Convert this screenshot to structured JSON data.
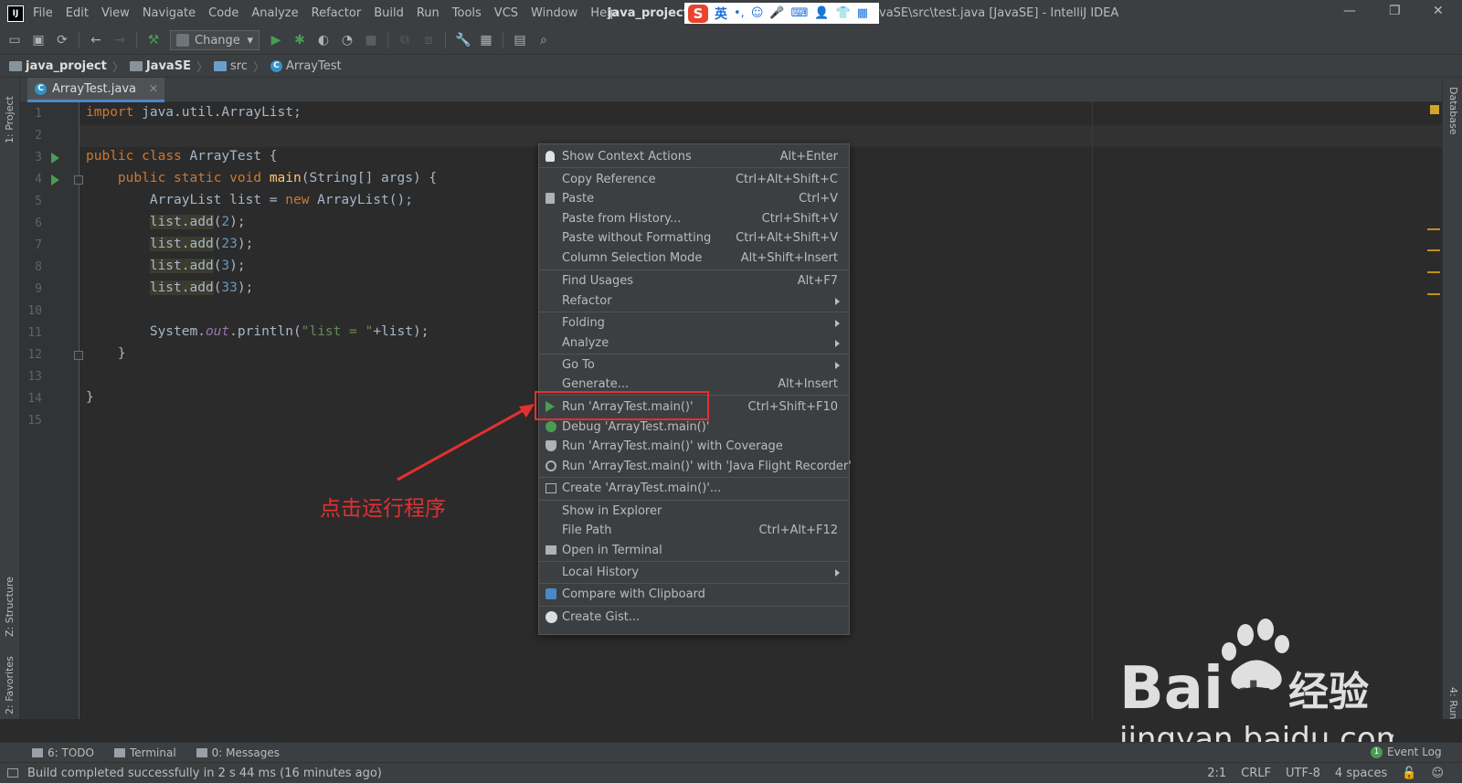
{
  "menubar": {
    "items": [
      "File",
      "Edit",
      "View",
      "Navigate",
      "Code",
      "Analyze",
      "Refactor",
      "Build",
      "Run",
      "Tools",
      "VCS",
      "Window",
      "Help"
    ],
    "title_project": "java_project",
    "title_prefix": "[",
    "title_suffix": "vaSE\\src\\test.java [JavaSE] - IntelliJ IDEA",
    "app_icon_text": "IJ"
  },
  "ime": {
    "logo": "S",
    "lang": "英",
    "punct": "•,",
    "icons": [
      "☺",
      "🎤",
      "⌨",
      "👤",
      "👕",
      "▦"
    ]
  },
  "toolbar": {
    "run_config_label": "Change"
  },
  "breadcrumb": {
    "items": [
      "java_project",
      "JavaSE",
      "src",
      "ArrayTest"
    ]
  },
  "editor": {
    "tab_label": "ArrayTest.java",
    "line_numbers": [
      "1",
      "2",
      "3",
      "4",
      "5",
      "6",
      "7",
      "8",
      "9",
      "10",
      "11",
      "12",
      "13",
      "14",
      "15"
    ]
  },
  "code": {
    "l1_kw": "import",
    "l1_rest": " java.util.ArrayList;",
    "l3_kw1": "public",
    "l3_kw2": "class",
    "l3_rest": " ArrayTest {",
    "l4_indent": "    ",
    "l4_kw1": "public",
    "l4_kw2": "static",
    "l4_kw3": "void",
    "l4_fn": "main",
    "l4_rest": "(String[] args) {",
    "l5_a": "        ArrayList list = ",
    "l5_kw": "new",
    "l5_b": " ArrayList();",
    "l6_call": "list.add",
    "l6_num": "2",
    "l7_call": "list.add",
    "l7_num": "23",
    "l8_call": "list.add",
    "l8_num": "3",
    "l9_call": "list.add",
    "l9_num": "33",
    "l11_a": "        System.",
    "l11_out": "out",
    "l11_b": ".println(",
    "l11_str": "\"list = \"",
    "l11_c": "+list);",
    "l12": "    }",
    "l14": "}"
  },
  "context_menu": {
    "items": [
      {
        "label": "Show Context Actions",
        "shortcut": "Alt+Enter"
      },
      {
        "label": "Copy Reference",
        "shortcut": "Ctrl+Alt+Shift+C"
      },
      {
        "label": "Paste",
        "shortcut": "Ctrl+V"
      },
      {
        "label": "Paste from History...",
        "shortcut": "Ctrl+Shift+V"
      },
      {
        "label": "Paste without Formatting",
        "shortcut": "Ctrl+Alt+Shift+V"
      },
      {
        "label": "Column Selection Mode",
        "shortcut": "Alt+Shift+Insert"
      },
      {
        "label": "Find Usages",
        "shortcut": "Alt+F7"
      },
      {
        "label": "Refactor",
        "shortcut": ""
      },
      {
        "label": "Folding",
        "shortcut": ""
      },
      {
        "label": "Analyze",
        "shortcut": ""
      },
      {
        "label": "Go To",
        "shortcut": ""
      },
      {
        "label": "Generate...",
        "shortcut": "Alt+Insert"
      },
      {
        "label": "Run 'ArrayTest.main()'",
        "shortcut": "Ctrl+Shift+F10"
      },
      {
        "label": "Debug 'ArrayTest.main()'",
        "shortcut": ""
      },
      {
        "label": "Run 'ArrayTest.main()' with Coverage",
        "shortcut": ""
      },
      {
        "label": "Run 'ArrayTest.main()' with 'Java Flight Recorder'",
        "shortcut": ""
      },
      {
        "label": "Create 'ArrayTest.main()'...",
        "shortcut": ""
      },
      {
        "label": "Show in Explorer",
        "shortcut": ""
      },
      {
        "label": "File Path",
        "shortcut": "Ctrl+Alt+F12"
      },
      {
        "label": "Open in Terminal",
        "shortcut": ""
      },
      {
        "label": "Local History",
        "shortcut": ""
      },
      {
        "label": "Compare with Clipboard",
        "shortcut": ""
      },
      {
        "label": "Create Gist...",
        "shortcut": ""
      }
    ]
  },
  "annotation": {
    "text": "点击运行程序"
  },
  "side_tabs": {
    "project": "1: Project",
    "structure": "Z: Structure",
    "favorites": "2: Favorites",
    "database": "Database",
    "run": "4: Run"
  },
  "tool_windows": {
    "todo": "6: TODO",
    "terminal": "Terminal",
    "messages": "0: Messages",
    "event_log": "Event Log",
    "event_count": "1"
  },
  "status": {
    "message": "Build completed successfully in 2 s 44 ms (16 minutes ago)",
    "position": "2:1",
    "line_sep": "CRLF",
    "encoding": "UTF-8",
    "indent": "4 spaces"
  },
  "watermark": {
    "brand": "Bai",
    "brand2": "du",
    "cn": "经验",
    "url": "jingyan.baidu.com"
  },
  "colors": {
    "accent": "#4a88c7",
    "run_green": "#499c54",
    "annotation_red": "#e33030"
  }
}
